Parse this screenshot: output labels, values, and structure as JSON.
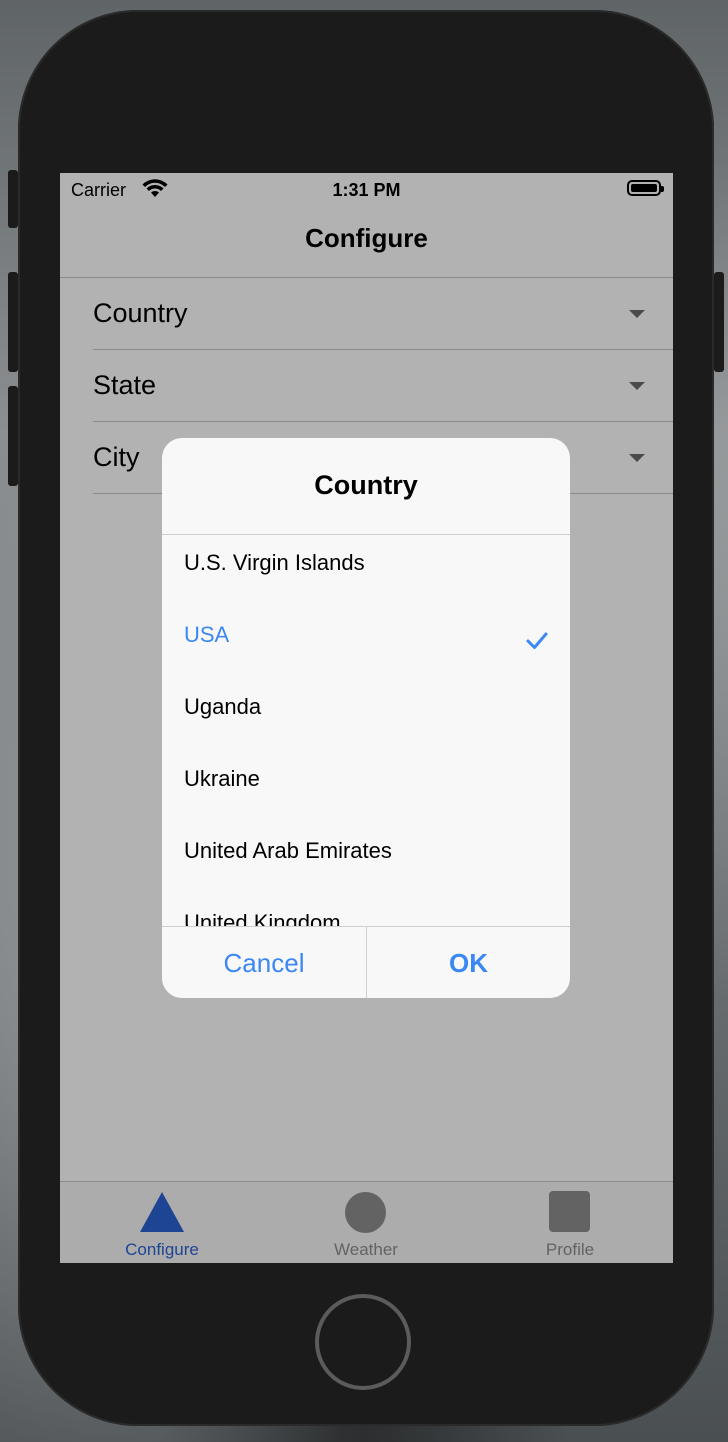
{
  "status_bar": {
    "carrier": "Carrier",
    "time": "1:31 PM",
    "wifi_icon": "wifi-icon",
    "battery_icon": "battery-icon"
  },
  "nav": {
    "title": "Configure"
  },
  "form": {
    "rows": [
      {
        "label": "Country"
      },
      {
        "label": "State"
      },
      {
        "label": "City"
      }
    ]
  },
  "dialog": {
    "title": "Country",
    "items": [
      {
        "label": "U.S. Virgin Islands",
        "selected": false
      },
      {
        "label": "USA",
        "selected": true
      },
      {
        "label": "Uganda",
        "selected": false
      },
      {
        "label": "Ukraine",
        "selected": false
      },
      {
        "label": "United Arab Emirates",
        "selected": false
      },
      {
        "label": "United Kingdom",
        "selected": false
      }
    ],
    "cancel_label": "Cancel",
    "ok_label": "OK"
  },
  "tabs": [
    {
      "label": "Configure",
      "icon": "triangle-icon",
      "active": true
    },
    {
      "label": "Weather",
      "icon": "circle-icon",
      "active": false
    },
    {
      "label": "Profile",
      "icon": "square-icon",
      "active": false
    }
  ],
  "colors": {
    "accent": "#3b87f4",
    "tab_active": "#2c64d4",
    "tab_inactive": "#8e8e8e"
  }
}
